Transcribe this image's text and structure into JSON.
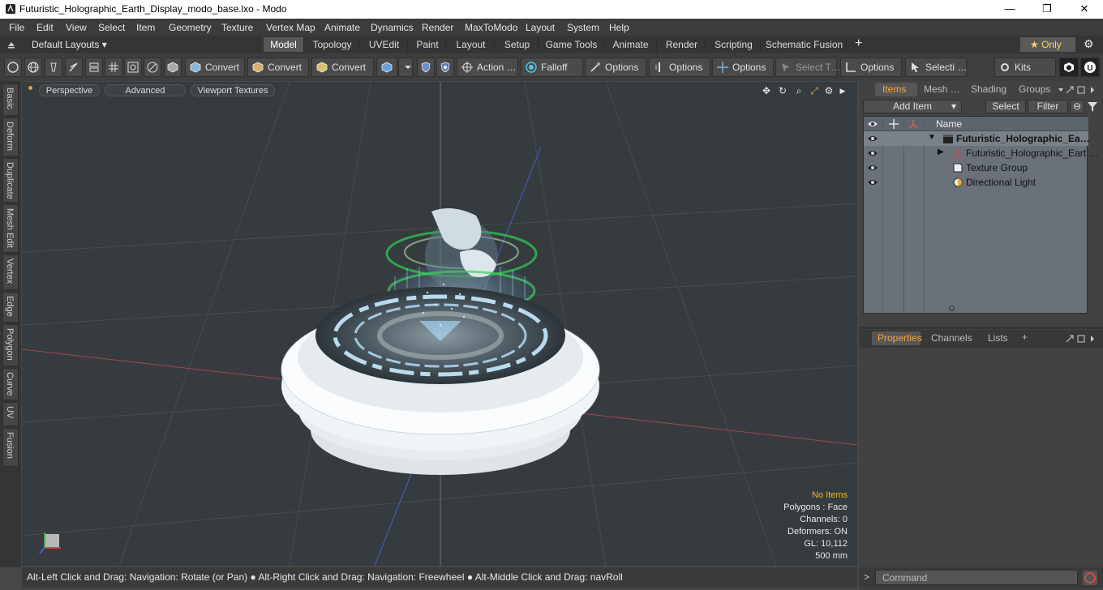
{
  "window": {
    "title": "Futuristic_Holographic_Earth_Display_modo_base.lxo - Modo",
    "minimize": "—",
    "maximize": "❐",
    "close": "✕"
  },
  "menu": [
    "File",
    "Edit",
    "View",
    "Select",
    "Item",
    "Geometry",
    "Texture",
    "Vertex Map",
    "Animate",
    "Dynamics",
    "Render",
    "MaxToModo",
    "Layout",
    "System",
    "Help"
  ],
  "layouts": {
    "dropdown": "Default Layouts ▾",
    "tabs": [
      "Model",
      "Topology",
      "UVEdit",
      "Paint",
      "Layout",
      "Setup",
      "Game Tools",
      "Animate",
      "Render",
      "Scripting",
      "Schematic Fusion"
    ],
    "active": "Model",
    "add": "+",
    "only": "★  Only",
    "gear": "⚙"
  },
  "toolbar": {
    "convert1": "Convert",
    "convert2": "Convert",
    "convert3": "Convert",
    "action": "Action  …",
    "falloff": "Falloff",
    "options1": "Options",
    "options2": "Options",
    "options3": "Options",
    "select_t": "Select T…",
    "options4": "Options",
    "selecti": "Selecti …",
    "kits": "Kits"
  },
  "left_tabs": [
    "Basic",
    "Deform",
    "Duplicate",
    "Mesh Edit",
    "Vertex",
    "Edge",
    "Polygon",
    "Curve",
    "UV",
    "Fusion"
  ],
  "viewport": {
    "perspective": "Perspective",
    "advanced": "Advanced",
    "textures": "Viewport Textures",
    "stats": {
      "no_items": "No Items",
      "polygons": "Polygons : Face",
      "channels": "Channels: 0",
      "deformers": "Deformers: ON",
      "gl": "GL: 10,112",
      "scale": "500 mm"
    }
  },
  "status_text": "Alt-Left Click and Drag: Navigation: Rotate (or Pan) ● Alt-Right Click and Drag: Navigation: Freewheel ● Alt-Middle Click and Drag: navRoll",
  "items_panel": {
    "tabs": [
      "Items",
      "Mesh …",
      "Shading",
      "Groups"
    ],
    "add_item": "Add Item",
    "select": "Select",
    "filter": "Filter",
    "name_col": "Name",
    "rows": [
      {
        "label": "Futuristic_Holographic_Ea…",
        "bold": true
      },
      {
        "label": "Futuristic_Holographic_Eart …",
        "bold": false
      },
      {
        "label": "Texture Group",
        "bold": false
      },
      {
        "label": "Directional Light",
        "bold": false
      }
    ]
  },
  "properties_panel": {
    "tabs": [
      "Properties",
      "Channels",
      "Lists"
    ],
    "add": "+"
  },
  "command": {
    "placeholder": "Command"
  },
  "colors": {
    "accent": "#f5a640",
    "viewport_bg": "#353b3f",
    "axis_x": "#b04444",
    "axis_z": "#4a5fc4"
  }
}
